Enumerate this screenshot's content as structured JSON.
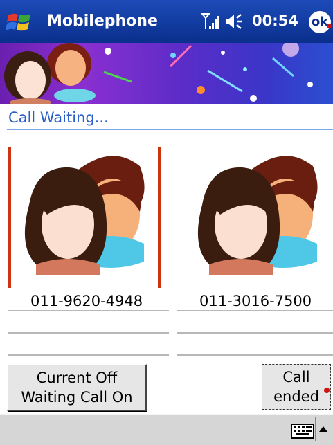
{
  "titlebar": {
    "app_title": "Mobilephone",
    "time": "00:54",
    "ok_label": "ok",
    "icons": [
      "windows-start-icon",
      "signal-strength-icon",
      "volume-icon",
      "ok-button"
    ]
  },
  "call": {
    "status": "Call Waiting...",
    "contacts": [
      {
        "number": "011-9620-4948",
        "avatar": "couple-avatar-icon",
        "selected": true
      },
      {
        "number": "011-3016-7500",
        "avatar": "couple-avatar-icon",
        "selected": false
      }
    ]
  },
  "buttons": {
    "left_line1": "Current Off",
    "left_line2": "Waiting Call On",
    "right_line1": "Call",
    "right_line2": "ended"
  },
  "taskbar": {
    "icons": [
      "keyboard-icon",
      "input-menu-arrow-icon"
    ]
  },
  "colors": {
    "titlebar": "#0a2f8c",
    "status_text": "#2a5fc8",
    "selection": "#cc3311",
    "taskbar": "#d6d6d6"
  }
}
